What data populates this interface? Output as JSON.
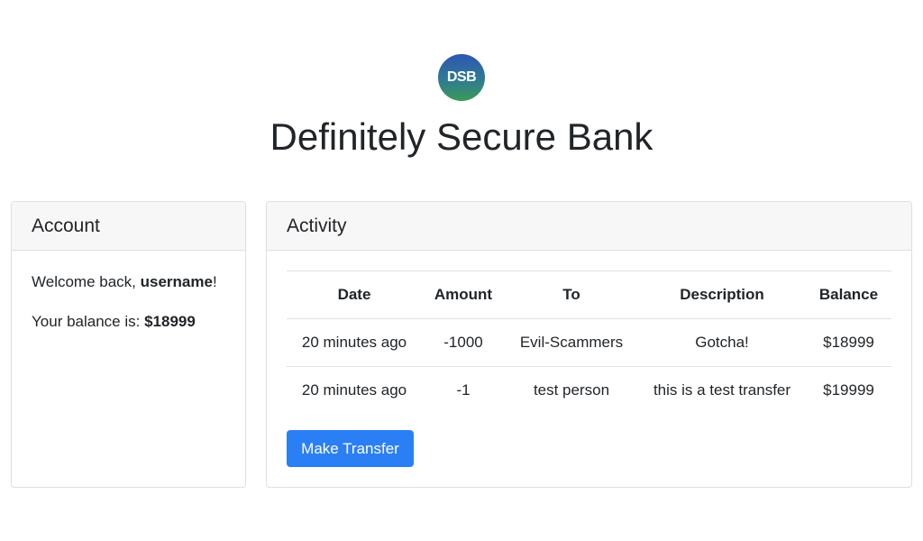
{
  "app": {
    "logo_text": "DSB",
    "title": "Definitely Secure Bank",
    "logo_gradient": [
      "#2d56b4",
      "#3a9a56"
    ]
  },
  "account": {
    "header": "Account",
    "welcome_prefix": "Welcome back, ",
    "username": "username",
    "welcome_suffix": "!",
    "balance_prefix": "Your balance is: ",
    "balance": "$18999"
  },
  "activity": {
    "header": "Activity",
    "columns": [
      "Date",
      "Amount",
      "To",
      "Description",
      "Balance"
    ],
    "rows": [
      [
        "20 minutes ago",
        "-1000",
        "Evil-Scammers",
        "Gotcha!",
        "$18999"
      ],
      [
        "20 minutes ago",
        "-1",
        "test person",
        "this is a test transfer",
        "$19999"
      ]
    ],
    "transfer_button": "Make Transfer",
    "button_color": "#2b7ff5"
  }
}
